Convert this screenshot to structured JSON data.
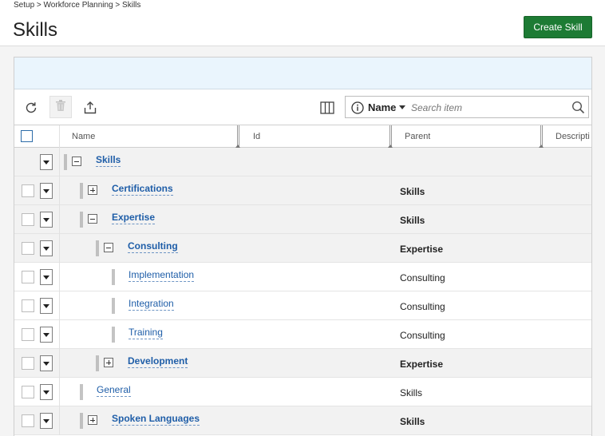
{
  "breadcrumb": {
    "items": [
      "Setup",
      "Workforce Planning",
      "Skills"
    ],
    "separator": ">"
  },
  "page": {
    "title": "Skills",
    "create_button_label": "Create Skill",
    "accent_color": "#1d7b34"
  },
  "toolbar": {
    "icons": [
      "refresh-icon",
      "trash-icon",
      "export-icon",
      "columns-icon"
    ]
  },
  "search": {
    "field": "Name",
    "placeholder": "Search item"
  },
  "grid": {
    "columns": [
      "Name",
      "Id",
      "Parent",
      "Descripti"
    ],
    "rows": [
      {
        "name": "Skills",
        "parent": "",
        "level": 0,
        "toggle": "minus",
        "bold": true,
        "checkbox": false
      },
      {
        "name": "Certifications",
        "parent": "Skills",
        "level": 1,
        "toggle": "plus",
        "bold": true,
        "checkbox": true
      },
      {
        "name": "Expertise",
        "parent": "Skills",
        "level": 1,
        "toggle": "minus",
        "bold": true,
        "checkbox": true
      },
      {
        "name": "Consulting",
        "parent": "Expertise",
        "level": 2,
        "toggle": "minus",
        "bold": true,
        "checkbox": true
      },
      {
        "name": "Implementation",
        "parent": "Consulting",
        "level": 3,
        "toggle": "none",
        "bold": false,
        "checkbox": true
      },
      {
        "name": "Integration",
        "parent": "Consulting",
        "level": 3,
        "toggle": "none",
        "bold": false,
        "checkbox": true
      },
      {
        "name": "Training",
        "parent": "Consulting",
        "level": 3,
        "toggle": "none",
        "bold": false,
        "checkbox": true
      },
      {
        "name": "Development",
        "parent": "Expertise",
        "level": 2,
        "toggle": "plus",
        "bold": true,
        "checkbox": true
      },
      {
        "name": "General",
        "parent": "Skills",
        "level": 1,
        "toggle": "none",
        "bold": false,
        "checkbox": true
      },
      {
        "name": "Spoken Languages",
        "parent": "Skills",
        "level": 1,
        "toggle": "plus",
        "bold": true,
        "checkbox": true
      }
    ]
  }
}
